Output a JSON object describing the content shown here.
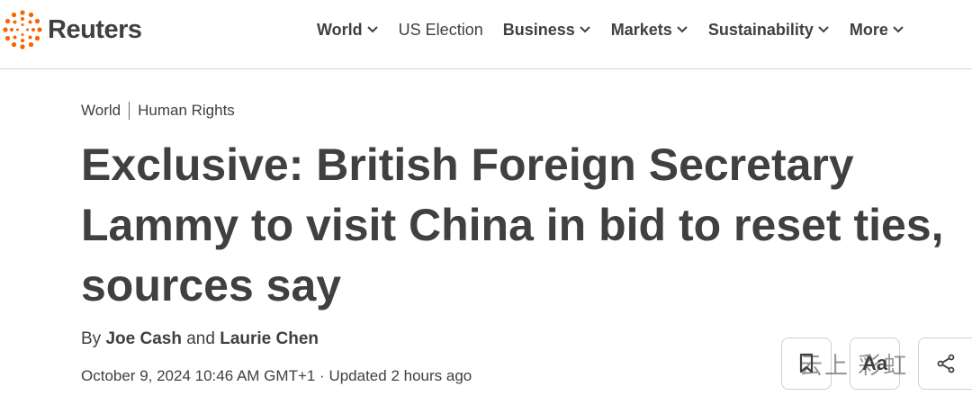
{
  "brand": {
    "name": "Reuters",
    "accent": "#fa6400"
  },
  "nav": {
    "items": [
      {
        "label": "World",
        "dropdown": true
      },
      {
        "label": "US Election",
        "dropdown": false
      },
      {
        "label": "Business",
        "dropdown": true
      },
      {
        "label": "Markets",
        "dropdown": true
      },
      {
        "label": "Sustainability",
        "dropdown": true
      },
      {
        "label": "More",
        "dropdown": true
      }
    ]
  },
  "breadcrumb": {
    "section": "World",
    "subsection": "Human Rights"
  },
  "article": {
    "headline": "Exclusive: British Foreign Secretary Lammy to visit China in bid to reset ties, sources say",
    "byline_prefix": "By",
    "author1": "Joe Cash",
    "byline_joiner": "and",
    "author2": "Laurie Chen",
    "dateline": "October 9, 2024 10:46 AM GMT+1 · Updated 2 hours ago"
  },
  "tools": {
    "text_size_label": "Aa"
  },
  "watermark": "云上 彩虹"
}
